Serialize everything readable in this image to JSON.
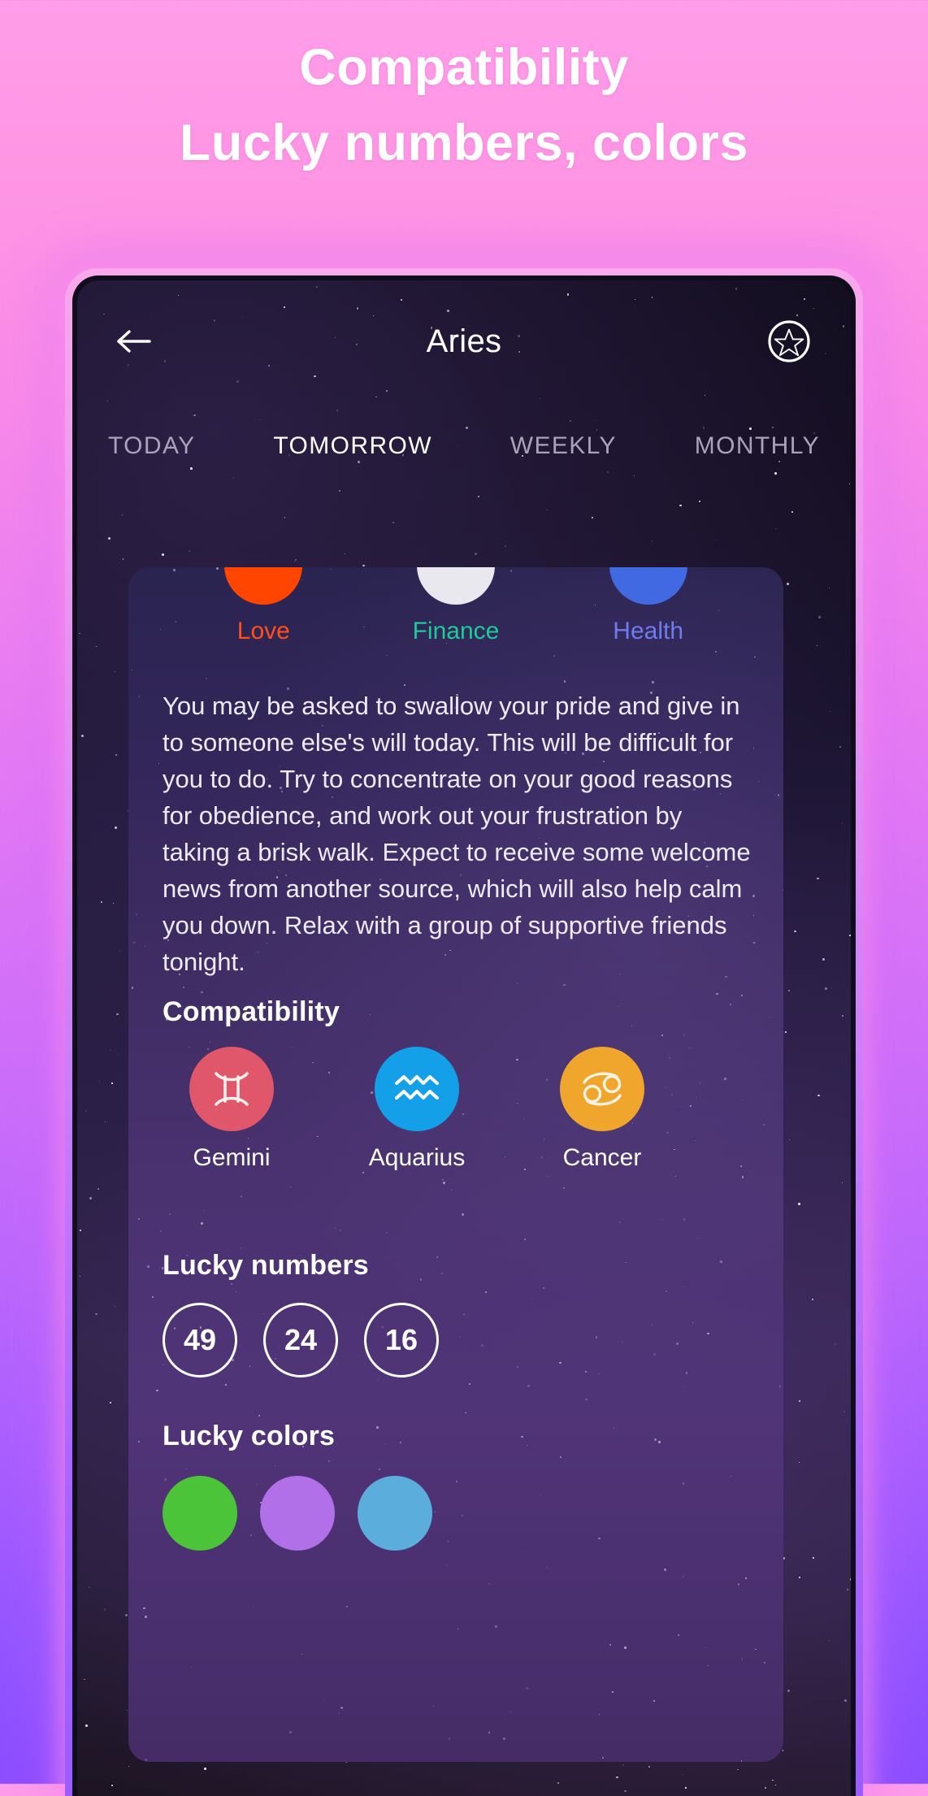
{
  "promo": {
    "line1": "Compatibility",
    "line2": "Lucky numbers, colors"
  },
  "appbar": {
    "back_icon": "arrow-left-icon",
    "title": "Aries",
    "action_icon": "pentagram-icon"
  },
  "tabs": [
    {
      "label": "TODAY",
      "active": false
    },
    {
      "label": "TOMORROW",
      "active": true
    },
    {
      "label": "WEEKLY",
      "active": false
    },
    {
      "label": "MONTHLY",
      "active": false
    }
  ],
  "metrics": [
    {
      "label": "Love",
      "ring_color": "#FF4500",
      "text_color": "#FF4F1A"
    },
    {
      "label": "Finance",
      "ring_color": "#E8E8EE",
      "text_color": "#1EC99A"
    },
    {
      "label": "Health",
      "ring_color": "#4169E1",
      "text_color": "#6E7CF0"
    }
  ],
  "horoscope": {
    "text": "You may be asked to swallow your pride and give in to someone else's will today. This will be difficult for you to do. Try to concentrate on your good reasons for obedience, and work out your frustration by taking a brisk walk. Expect to receive some welcome news from another source, which will also help calm you down. Relax with a group of supportive friends tonight."
  },
  "compatibility": {
    "title": "Compatibility",
    "signs": [
      {
        "name": "Gemini",
        "bg": "#E0566A",
        "icon": "gemini-icon"
      },
      {
        "name": "Aquarius",
        "bg": "#13A0E8",
        "icon": "aquarius-icon"
      },
      {
        "name": "Cancer",
        "bg": "#F0A52C",
        "icon": "cancer-icon"
      }
    ]
  },
  "lucky_numbers": {
    "title": "Lucky numbers",
    "values": [
      "49",
      "24",
      "16"
    ]
  },
  "lucky_colors": {
    "title": "Lucky colors",
    "values": [
      "#4CC439",
      "#B170E8",
      "#5BAEDB"
    ]
  }
}
